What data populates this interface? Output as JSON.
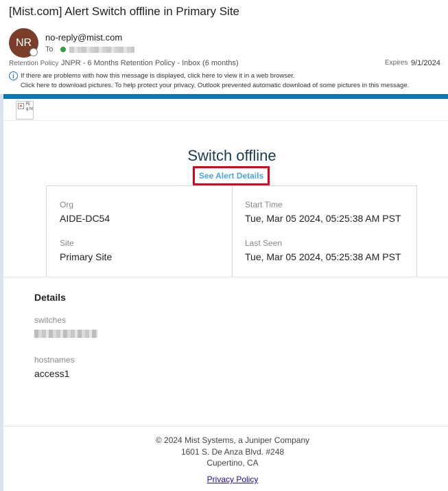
{
  "email": {
    "subject": "[Mist.com] Alert Switch offline in Primary Site",
    "sender_initials": "NR",
    "sender": "no-reply@mist.com",
    "to_label": "To",
    "retention_label": "Retention Policy",
    "retention_value": "JNPR - 6 Months Retention Policy - Inbox (6 months)",
    "expires_label": "Expires",
    "expires_value": "9/1/2024",
    "info_line1": "If there are problems with how this message is displayed, click here to view it in a web browser.",
    "info_line2": "Click here to download pictures. To help protect your privacy, Outlook prevented automatic download of some pictures in this message.",
    "broken_image_alt": "Ri g ht"
  },
  "alert": {
    "title": "Switch offline",
    "details_link": "See Alert Details",
    "org_label": "Org",
    "org_value": "AIDE-DC54",
    "site_label": "Site",
    "site_value": "Primary Site",
    "start_label": "Start Time",
    "start_value": "Tue, Mar 05 2024, 05:25:38 AM PST",
    "last_seen_label": "Last Seen",
    "last_seen_value": "Tue, Mar 05 2024, 05:25:38 AM PST"
  },
  "details": {
    "heading": "Details",
    "switches_label": "switches",
    "hostnames_label": "hostnames",
    "hostnames_value": "access1"
  },
  "footer": {
    "copyright": "© 2024 Mist Systems, a Juniper Company",
    "address1": "1601 S. De Anza Blvd. #248",
    "address2": "Cupertino, CA",
    "privacy": "Privacy Policy"
  },
  "colors": {
    "accent_bar": "#0a78b4",
    "highlight_border": "#e0001b",
    "link": "#4aa7dc",
    "avatar": "#7a3e2b"
  }
}
